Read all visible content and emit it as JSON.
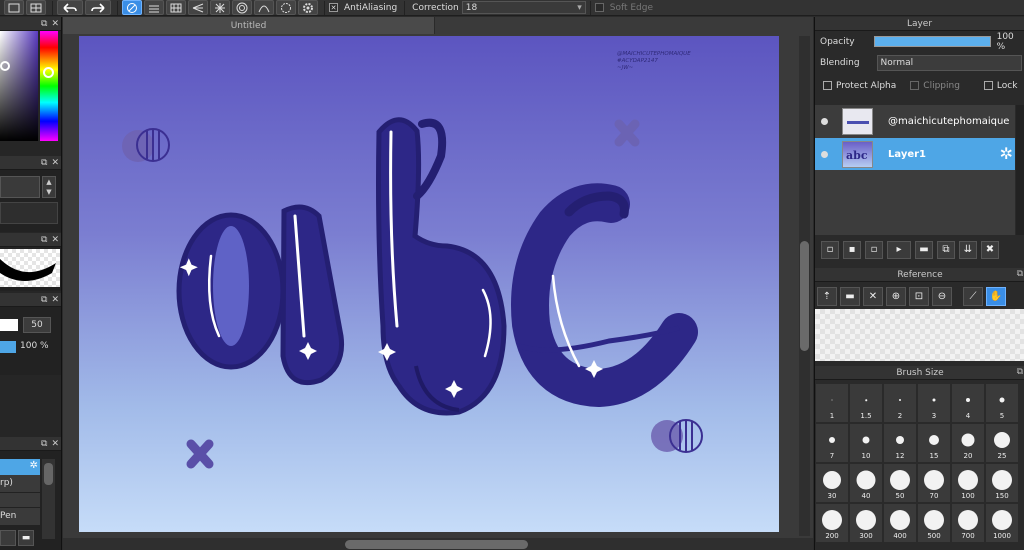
{
  "toolbar": {
    "antialiasing_label": "AntiAliasing",
    "correction_label": "Correction",
    "correction_value": "18",
    "soft_edge_label": "Soft Edge"
  },
  "document": {
    "tab_title": "Untitled"
  },
  "canvas": {
    "watermark_lines": [
      "@MAICHICUTEPHOMAIQUE",
      "#ACYDAP2147",
      "~JW~"
    ],
    "lettering": "abc",
    "colors": {
      "gradient_top": "#5c55c0",
      "gradient_bottom": "#c6dcf8",
      "letter_fill": "#322d8c",
      "decor": "#5a4fa8"
    }
  },
  "left_panel": {
    "brush_density_value": "50",
    "opacity_value": "100 %",
    "tool_list": [
      "rp)",
      "Pen"
    ]
  },
  "layer_panel": {
    "title": "Layer",
    "opacity_label": "Opacity",
    "opacity_value": "100 %",
    "opacity_fraction": 1.0,
    "blending_label": "Blending",
    "blending_value": "Normal",
    "protect_alpha_label": "Protect Alpha",
    "clipping_label": "Clipping",
    "lock_label": "Lock",
    "layers": [
      {
        "name": "@maichicutephomaique",
        "selected": false
      },
      {
        "name": "Layer1",
        "selected": true
      }
    ]
  },
  "reference_panel": {
    "title": "Reference"
  },
  "brush_size_panel": {
    "title": "Brush Size",
    "sizes": [
      "1",
      "1.5",
      "2",
      "3",
      "4",
      "5",
      "7",
      "10",
      "12",
      "15",
      "20",
      "25",
      "30",
      "40",
      "50",
      "70",
      "100",
      "150",
      "200",
      "300",
      "400",
      "500",
      "700",
      "1000"
    ]
  },
  "accent_color": "#4ea6e6"
}
